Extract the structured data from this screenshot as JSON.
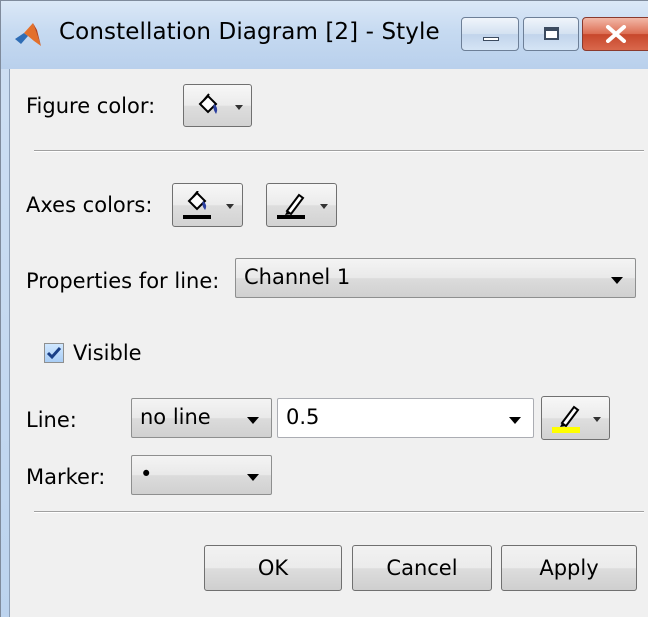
{
  "window": {
    "title": "Constellation Diagram [2] - Style"
  },
  "figure": {
    "label": "Figure color:"
  },
  "axes": {
    "label": "Axes colors:"
  },
  "properties": {
    "label": "Properties for line:",
    "selected": "Channel 1"
  },
  "visible": {
    "label": "Visible",
    "checked": true
  },
  "line": {
    "label": "Line:",
    "style": "no line",
    "width": "0.5",
    "color": "#ffff00"
  },
  "marker": {
    "label": "Marker:",
    "value": "•"
  },
  "buttons": {
    "ok": "OK",
    "cancel": "Cancel",
    "apply": "Apply"
  },
  "colors": {
    "accent": "#3b6fb6",
    "line_color": "#ffff00"
  }
}
